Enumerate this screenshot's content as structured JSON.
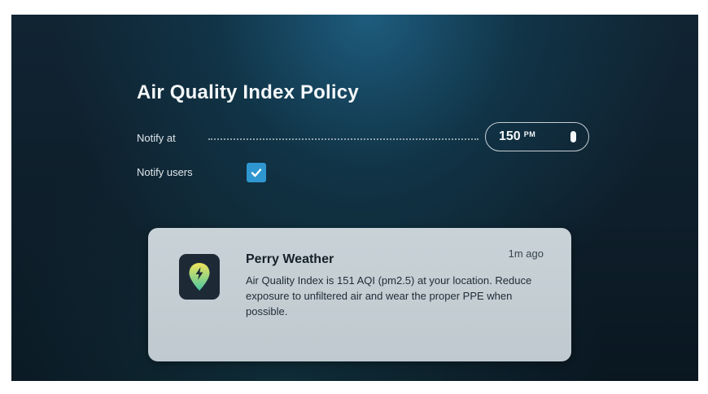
{
  "policy": {
    "title": "Air Quality Index Policy",
    "notify_at_label": "Notify at",
    "threshold_value": "150",
    "threshold_unit": "PM",
    "notify_users_label": "Notify users",
    "notify_users_checked": true
  },
  "notification": {
    "app_name": "Perry Weather",
    "time_ago": "1m ago",
    "message": "Air Quality Index is 151 AQI (pm2.5) at your location. Reduce exposure to unfiltered air and wear the proper PPE when possible.",
    "app_icon": "map-pin-lightning-icon"
  },
  "colors": {
    "accent": "#2f97cf",
    "icon_gradient_top": "#f2e35a",
    "icon_gradient_bottom": "#48c7a3"
  }
}
